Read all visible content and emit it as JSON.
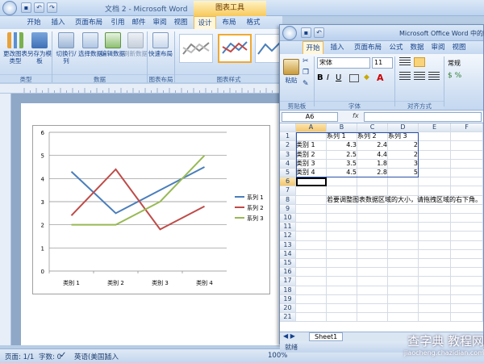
{
  "word": {
    "title": "文档 2 - Microsoft Word",
    "chart_tools_label": "图表工具",
    "tabs": [
      "开始",
      "插入",
      "页面布局",
      "引用",
      "邮件",
      "审阅",
      "视图",
      "设计",
      "布局",
      "格式"
    ],
    "active_tab": "设计",
    "ribbon_buttons": {
      "change_type": "更改图表类型",
      "save_template": "另存为模板",
      "switch_row_col": "切换行/列",
      "select_data": "选择数据",
      "edit_data": "编辑数据",
      "refresh_data": "刷新数据",
      "quick_layout": "快速布局"
    },
    "ribbon_groups": {
      "type": "类型",
      "data": "数据",
      "layouts": "图表布局",
      "styles": "图表样式"
    },
    "status": {
      "page": "页面: 1/1",
      "words": "字数: 0",
      "language": "英语(美国)",
      "mode": "插入",
      "zoom": "100%"
    }
  },
  "chart_data": {
    "type": "line",
    "categories": [
      "类别 1",
      "类别 2",
      "类别 3",
      "类别 4"
    ],
    "series": [
      {
        "name": "系列 1",
        "values": [
          4.3,
          2.5,
          3.5,
          4.5
        ],
        "color": "#4a7ebb"
      },
      {
        "name": "系列 2",
        "values": [
          2.4,
          4.4,
          1.8,
          2.8
        ],
        "color": "#be4b48"
      },
      {
        "name": "系列 3",
        "values": [
          2,
          2,
          3,
          5
        ],
        "color": "#98b954"
      }
    ],
    "ylim": [
      0,
      6
    ],
    "yticks": [
      0,
      1,
      2,
      3,
      4,
      5,
      6
    ],
    "grid": true,
    "legend": "right"
  },
  "excel": {
    "title": "Microsoft Office Word 中的图表",
    "tabs": [
      "开始",
      "插入",
      "页面布局",
      "公式",
      "数据",
      "审阅",
      "视图"
    ],
    "active_tab": "开始",
    "font_name": "宋体",
    "font_size": "11",
    "number_format": "常规",
    "clipboard_group": "剪贴板",
    "font_group": "字体",
    "align_group": "对齐方式",
    "paste_label": "粘贴",
    "name_box": "A6",
    "fx": "fx",
    "columns": [
      "A",
      "B",
      "C",
      "D",
      "E",
      "F"
    ],
    "row_numbers": [
      "1",
      "2",
      "3",
      "4",
      "5",
      "6",
      "7",
      "8",
      "9",
      "10",
      "11",
      "12",
      "13",
      "14",
      "15",
      "16",
      "17",
      "18",
      "19",
      "20",
      "21"
    ],
    "header_row": [
      "",
      "系列 1",
      "系列 2",
      "系列 3"
    ],
    "rows": [
      [
        "类别 1",
        "4.3",
        "2.4",
        "2"
      ],
      [
        "类别 2",
        "2.5",
        "4.4",
        "2"
      ],
      [
        "类别 3",
        "3.5",
        "1.8",
        "3"
      ],
      [
        "类别 4",
        "4.5",
        "2.8",
        "5"
      ]
    ],
    "note": "若要调整图表数据区域的大小，请拖拽区域的右下角。",
    "sheet_tab": "Sheet1",
    "status": "就绪"
  },
  "watermark": {
    "main": "查字典 教程网",
    "url": "jiaocheng.chazidian.com"
  }
}
